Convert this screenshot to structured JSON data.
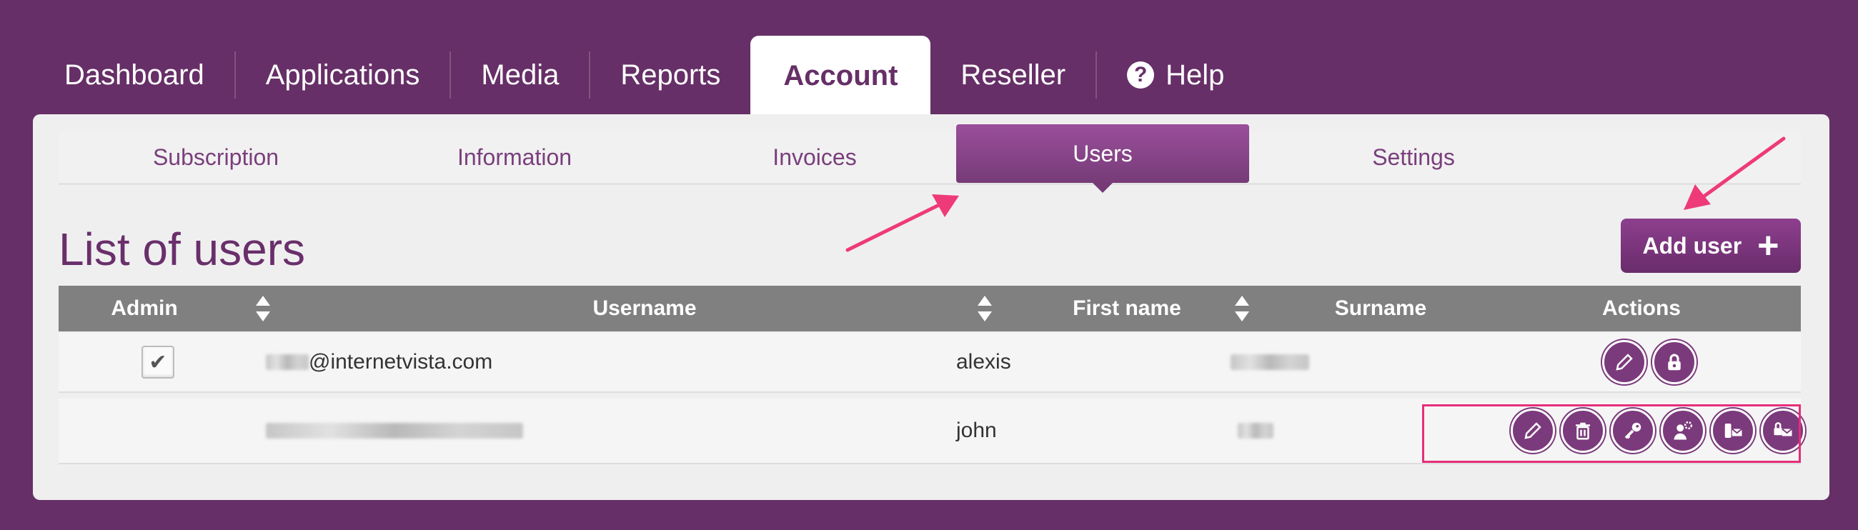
{
  "topnav": {
    "tabs": [
      "Dashboard",
      "Applications",
      "Media",
      "Reports",
      "Account",
      "Reseller",
      "Help"
    ],
    "active": "Account"
  },
  "subnav": {
    "tabs": [
      "Subscription",
      "Information",
      "Invoices",
      "Users",
      "Settings"
    ],
    "active": "Users"
  },
  "page": {
    "title": "List of users",
    "add_user_label": "Add user"
  },
  "table": {
    "columns": [
      "Admin",
      "Username",
      "First name",
      "Surname",
      "Actions"
    ],
    "rows": [
      {
        "admin": true,
        "username": "@internetvista.com",
        "first_name": "alexis",
        "surname": ""
      },
      {
        "admin": false,
        "username": "",
        "first_name": "john",
        "surname": ""
      }
    ]
  },
  "icons": {
    "row1_actions": [
      "edit-icon",
      "lock-icon"
    ],
    "row2_actions": [
      "edit-icon",
      "trash-icon",
      "key-icon",
      "user-settings-icon",
      "sms-alert-icon",
      "email-alert-icon"
    ]
  },
  "colors": {
    "brand": "#662f67",
    "annotation": "#e62e7a"
  }
}
